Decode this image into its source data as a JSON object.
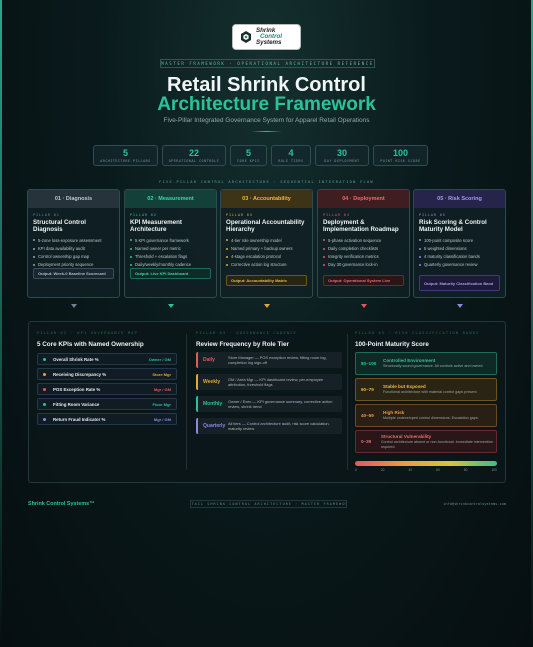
{
  "logo": {
    "line1": "Shrink",
    "line2": "Control",
    "line3": "Systems"
  },
  "tagline": "MASTER FRAMEWORK · OPERATIONAL ARCHITECTURE REFERENCE",
  "title_line1": "Retail Shrink Control",
  "title_line2": "Architecture Framework",
  "subtitle": "Five-Pillar Integrated Governance System for Apparel Retail Operations",
  "stats": [
    {
      "value": "5",
      "label": "ARCHITECTURE PILLARS"
    },
    {
      "value": "22",
      "label": "OPERATIONAL CONTROLS"
    },
    {
      "value": "5",
      "label": "CORE KPIS"
    },
    {
      "value": "4",
      "label": "ROLE TIERS"
    },
    {
      "value": "30",
      "label": "DAY DEPLOYMENT"
    },
    {
      "value": "100",
      "label": "POINT RISK SCORE"
    }
  ],
  "flow_label": "FIVE-PILLAR CONTROL ARCHITECTURE · SEQUENTIAL INTEGRATION FLOW",
  "pillars": [
    {
      "header": "01 · Diagnosis",
      "tag": "PILLAR 01",
      "title": "Structural Control Diagnosis",
      "items": [
        "5-zone loss-exposure assessment",
        "KPI data availability audit",
        "Control ownership gap map",
        "Deployment priority sequence"
      ],
      "output": "Output: Week-0 Baseline Scorecard",
      "color": "#8fa3b3"
    },
    {
      "header": "02 · Measurement",
      "tag": "PILLAR 02",
      "title": "KPI Measurement Architecture",
      "items": [
        "5 KPI governance framework",
        "Named owner per metric",
        "Threshold + escalation flags",
        "Daily/weekly/monthly cadence"
      ],
      "output": "Output: Live KPI Dashboard",
      "color": "#2bc29b"
    },
    {
      "header": "03 · Accountability",
      "tag": "PILLAR 03",
      "title": "Operational Accountability Hierarchy",
      "items": [
        "4-tier role ownership model",
        "Named primary + backup owners",
        "4-stage escalation protocol",
        "Corrective action log structure"
      ],
      "output": "Output: Accountability Matrix",
      "color": "#e0a93a"
    },
    {
      "header": "04 · Deployment",
      "tag": "PILLAR 04",
      "title": "Deployment & Implementation Roadmap",
      "items": [
        "5-phase activation sequence",
        "Daily completion checklists",
        "Integrity verification metrics",
        "Day 30 governance lock-in"
      ],
      "output": "Output: Operational System Live",
      "color": "#e05a5a"
    },
    {
      "header": "05 · Risk Scoring",
      "tag": "PILLAR 05",
      "title": "Risk Scoring & Control Maturity Model",
      "items": [
        "100-point composite score",
        "5 weighted dimensions",
        "4 maturity classification bands",
        "Quarterly governance review"
      ],
      "output": "Output: Maturity Classification Band",
      "color": "#8f86e0"
    }
  ],
  "col1": {
    "tag": "PILLAR 02 · KPI GOVERNANCE MAP",
    "title": "5 Core KPIs with Named Ownership",
    "kpis": [
      {
        "name": "Overall Shrink Rate %",
        "owner": "Owner / GM",
        "color": "#2bc29b"
      },
      {
        "name": "Receiving Discrepancy %",
        "owner": "Store Mgr",
        "color": "#e0a93a"
      },
      {
        "name": "POS Exception Rate %",
        "owner": "Mgr / GM",
        "color": "#e05a5a"
      },
      {
        "name": "Fitting Room Variance",
        "owner": "Floor Mgr",
        "color": "#2bc29b"
      },
      {
        "name": "Return Fraud Indicator %",
        "owner": "Mgr / GM",
        "color": "#8f86e0"
      }
    ]
  },
  "col2": {
    "tag": "PILLAR 03 · GOVERNANCE CADENCE",
    "title": "Review Frequency by Role Tier",
    "rows": [
      {
        "tier": "Daily",
        "desc": "Store Manager — POS exception review, fitting room log, completion log sign-off",
        "color": "#e05a5a"
      },
      {
        "tier": "Weekly",
        "desc": "GM / Area Mgr — KPI dashboard review, per-employee attribution, threshold flags",
        "color": "#e0a93a"
      },
      {
        "tier": "Monthly",
        "desc": "Owner / Exec — KPI governance summary, corrective action review, shrink trend",
        "color": "#2bc29b"
      },
      {
        "tier": "Quarterly",
        "desc": "All tiers — Control architecture audit, risk score calculation, maturity review",
        "color": "#8f86e0"
      }
    ]
  },
  "col3": {
    "tag": "PILLAR 05 · RISK CLASSIFICATION BANDS",
    "title": "100-Point Maturity Score",
    "bands": [
      {
        "range": "80–100",
        "name": "Controlled Environment",
        "desc": "Structurally sound governance. All controls active and owned.",
        "color": "#2bc29b"
      },
      {
        "range": "60–79",
        "name": "Stable but Exposed",
        "desc": "Functional architecture with material control gaps present.",
        "color": "#e0a93a"
      },
      {
        "range": "40–59",
        "name": "High Risk",
        "desc": "Multiple undeveloped control dimensions. Escalation gaps.",
        "color": "#e79a45"
      },
      {
        "range": "0–39",
        "name": "Structural Vulnerability",
        "desc": "Control architecture absent or non-functional. Immediate intervention required.",
        "color": "#e05a5a"
      }
    ],
    "scale": [
      "0",
      "20",
      "40",
      "60",
      "80",
      "100"
    ]
  },
  "footer": {
    "brand": "Shrink Control Systems™",
    "middle": "RETAIL SHRINK CONTROL ARCHITECTURE · MASTER FRAMEWORK",
    "email": "info@shrinkcontrolsystems.com"
  }
}
